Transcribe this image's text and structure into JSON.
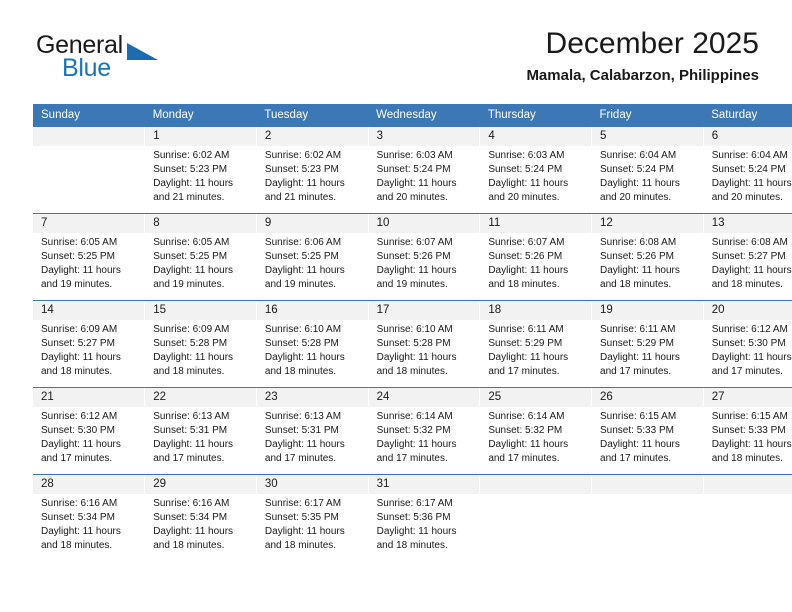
{
  "brand": {
    "name_part1": "General",
    "name_part2": "Blue",
    "accent_color": "#1b6cb0"
  },
  "header": {
    "title": "December 2025",
    "subtitle": "Mamala, Calabarzon, Philippines"
  },
  "calendar": {
    "header_color": "#3b78b5",
    "weekdays": [
      "Sunday",
      "Monday",
      "Tuesday",
      "Wednesday",
      "Thursday",
      "Friday",
      "Saturday"
    ],
    "weeks": [
      [
        {
          "day": "",
          "lines": []
        },
        {
          "day": "1",
          "lines": [
            "Sunrise: 6:02 AM",
            "Sunset: 5:23 PM",
            "Daylight: 11 hours",
            "and 21 minutes."
          ]
        },
        {
          "day": "2",
          "lines": [
            "Sunrise: 6:02 AM",
            "Sunset: 5:23 PM",
            "Daylight: 11 hours",
            "and 21 minutes."
          ]
        },
        {
          "day": "3",
          "lines": [
            "Sunrise: 6:03 AM",
            "Sunset: 5:24 PM",
            "Daylight: 11 hours",
            "and 20 minutes."
          ]
        },
        {
          "day": "4",
          "lines": [
            "Sunrise: 6:03 AM",
            "Sunset: 5:24 PM",
            "Daylight: 11 hours",
            "and 20 minutes."
          ]
        },
        {
          "day": "5",
          "lines": [
            "Sunrise: 6:04 AM",
            "Sunset: 5:24 PM",
            "Daylight: 11 hours",
            "and 20 minutes."
          ]
        },
        {
          "day": "6",
          "lines": [
            "Sunrise: 6:04 AM",
            "Sunset: 5:24 PM",
            "Daylight: 11 hours",
            "and 20 minutes."
          ]
        }
      ],
      [
        {
          "day": "7",
          "lines": [
            "Sunrise: 6:05 AM",
            "Sunset: 5:25 PM",
            "Daylight: 11 hours",
            "and 19 minutes."
          ]
        },
        {
          "day": "8",
          "lines": [
            "Sunrise: 6:05 AM",
            "Sunset: 5:25 PM",
            "Daylight: 11 hours",
            "and 19 minutes."
          ]
        },
        {
          "day": "9",
          "lines": [
            "Sunrise: 6:06 AM",
            "Sunset: 5:25 PM",
            "Daylight: 11 hours",
            "and 19 minutes."
          ]
        },
        {
          "day": "10",
          "lines": [
            "Sunrise: 6:07 AM",
            "Sunset: 5:26 PM",
            "Daylight: 11 hours",
            "and 19 minutes."
          ]
        },
        {
          "day": "11",
          "lines": [
            "Sunrise: 6:07 AM",
            "Sunset: 5:26 PM",
            "Daylight: 11 hours",
            "and 18 minutes."
          ]
        },
        {
          "day": "12",
          "lines": [
            "Sunrise: 6:08 AM",
            "Sunset: 5:26 PM",
            "Daylight: 11 hours",
            "and 18 minutes."
          ]
        },
        {
          "day": "13",
          "lines": [
            "Sunrise: 6:08 AM",
            "Sunset: 5:27 PM",
            "Daylight: 11 hours",
            "and 18 minutes."
          ]
        }
      ],
      [
        {
          "day": "14",
          "lines": [
            "Sunrise: 6:09 AM",
            "Sunset: 5:27 PM",
            "Daylight: 11 hours",
            "and 18 minutes."
          ]
        },
        {
          "day": "15",
          "lines": [
            "Sunrise: 6:09 AM",
            "Sunset: 5:28 PM",
            "Daylight: 11 hours",
            "and 18 minutes."
          ]
        },
        {
          "day": "16",
          "lines": [
            "Sunrise: 6:10 AM",
            "Sunset: 5:28 PM",
            "Daylight: 11 hours",
            "and 18 minutes."
          ]
        },
        {
          "day": "17",
          "lines": [
            "Sunrise: 6:10 AM",
            "Sunset: 5:28 PM",
            "Daylight: 11 hours",
            "and 18 minutes."
          ]
        },
        {
          "day": "18",
          "lines": [
            "Sunrise: 6:11 AM",
            "Sunset: 5:29 PM",
            "Daylight: 11 hours",
            "and 17 minutes."
          ]
        },
        {
          "day": "19",
          "lines": [
            "Sunrise: 6:11 AM",
            "Sunset: 5:29 PM",
            "Daylight: 11 hours",
            "and 17 minutes."
          ]
        },
        {
          "day": "20",
          "lines": [
            "Sunrise: 6:12 AM",
            "Sunset: 5:30 PM",
            "Daylight: 11 hours",
            "and 17 minutes."
          ]
        }
      ],
      [
        {
          "day": "21",
          "lines": [
            "Sunrise: 6:12 AM",
            "Sunset: 5:30 PM",
            "Daylight: 11 hours",
            "and 17 minutes."
          ]
        },
        {
          "day": "22",
          "lines": [
            "Sunrise: 6:13 AM",
            "Sunset: 5:31 PM",
            "Daylight: 11 hours",
            "and 17 minutes."
          ]
        },
        {
          "day": "23",
          "lines": [
            "Sunrise: 6:13 AM",
            "Sunset: 5:31 PM",
            "Daylight: 11 hours",
            "and 17 minutes."
          ]
        },
        {
          "day": "24",
          "lines": [
            "Sunrise: 6:14 AM",
            "Sunset: 5:32 PM",
            "Daylight: 11 hours",
            "and 17 minutes."
          ]
        },
        {
          "day": "25",
          "lines": [
            "Sunrise: 6:14 AM",
            "Sunset: 5:32 PM",
            "Daylight: 11 hours",
            "and 17 minutes."
          ]
        },
        {
          "day": "26",
          "lines": [
            "Sunrise: 6:15 AM",
            "Sunset: 5:33 PM",
            "Daylight: 11 hours",
            "and 17 minutes."
          ]
        },
        {
          "day": "27",
          "lines": [
            "Sunrise: 6:15 AM",
            "Sunset: 5:33 PM",
            "Daylight: 11 hours",
            "and 18 minutes."
          ]
        }
      ],
      [
        {
          "day": "28",
          "lines": [
            "Sunrise: 6:16 AM",
            "Sunset: 5:34 PM",
            "Daylight: 11 hours",
            "and 18 minutes."
          ]
        },
        {
          "day": "29",
          "lines": [
            "Sunrise: 6:16 AM",
            "Sunset: 5:34 PM",
            "Daylight: 11 hours",
            "and 18 minutes."
          ]
        },
        {
          "day": "30",
          "lines": [
            "Sunrise: 6:17 AM",
            "Sunset: 5:35 PM",
            "Daylight: 11 hours",
            "and 18 minutes."
          ]
        },
        {
          "day": "31",
          "lines": [
            "Sunrise: 6:17 AM",
            "Sunset: 5:36 PM",
            "Daylight: 11 hours",
            "and 18 minutes."
          ]
        },
        {
          "day": "",
          "lines": []
        },
        {
          "day": "",
          "lines": []
        },
        {
          "day": "",
          "lines": []
        }
      ]
    ]
  }
}
